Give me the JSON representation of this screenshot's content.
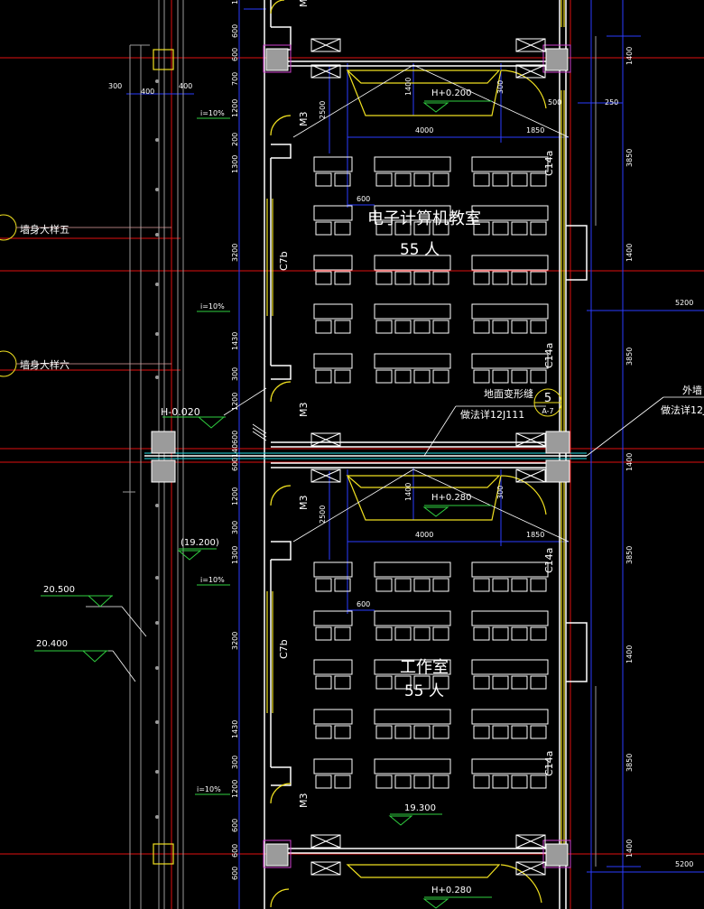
{
  "rooms": [
    {
      "name": "电子计算机教室",
      "capacity": "55 人"
    },
    {
      "name": "工作室",
      "capacity": "55 人"
    }
  ],
  "callouts": {
    "wall_detail_5": "墙身大样五",
    "wall_detail_6": "墙身大样六",
    "floor_joint": "地面变形缝",
    "floor_joint_ref": "做法详12J111",
    "outer_wall": "外墙",
    "outer_wall_ref": "做法详12J",
    "index_num": "5",
    "index_sheet": "A-7"
  },
  "levels": {
    "platform_upper": "H+0.200",
    "platform_lower": "H+0.280",
    "platform_bottom": "H+0.280",
    "floor_neg": "H-0.020",
    "floor_level": "(19.200)",
    "floor_level2": "19.300",
    "roof_1": "20.500",
    "roof_2": "20.400"
  },
  "slopes": {
    "s1": "i=10%",
    "s2": "i=10%",
    "s3": "i=10%",
    "s4": "i=10%"
  },
  "marks": {
    "door": "M3",
    "window_left": "C7b",
    "window_right_1": "C14a",
    "window_right_2": "C14a",
    "window_right_3": "C14a"
  },
  "dims": {
    "d300": "300",
    "d400a": "400",
    "d400b": "400",
    "d500": "500",
    "d250": "250",
    "d4000a": "4000",
    "d4000b": "4000",
    "d1850a": "1850",
    "d1850b": "1850",
    "d2500a": "2500",
    "d2500b": "2500",
    "d1400a": "1400",
    "d1400b": "1400",
    "d600a": "600",
    "d600b": "600",
    "d5200a": "5200",
    "d5200b": "5200",
    "d300c": "300",
    "d300d": "300",
    "left_col": [
      "120",
      "600",
      "600",
      "700",
      "1200",
      "200",
      "1300",
      "3200",
      "1430",
      "300",
      "1200",
      "600",
      "140",
      "600",
      "1200",
      "300",
      "1300",
      "3200",
      "1430",
      "300",
      "1200",
      "600",
      "600",
      "600"
    ],
    "right_col": [
      "1400",
      "3850",
      "1400",
      "3850",
      "1400",
      "3850",
      "1400",
      "3850",
      "1400"
    ]
  }
}
